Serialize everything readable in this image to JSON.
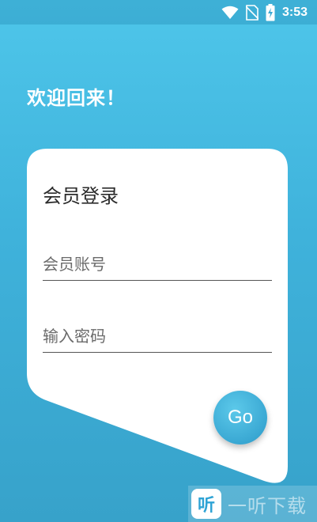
{
  "status_bar": {
    "time": "3:53",
    "icons": [
      "wifi-icon",
      "no-sim-icon",
      "battery-charging-icon"
    ]
  },
  "welcome_text": "欢迎回来！",
  "login_card": {
    "title": "会员登录",
    "account_placeholder": "会员账号",
    "password_placeholder": "输入密码",
    "go_label": "Go"
  },
  "watermark": {
    "logo_char": "听",
    "text": "一听下载"
  },
  "colors": {
    "background_top": "#4ec6ea",
    "background_bottom": "#37a2ca",
    "card": "#ffffff",
    "go_button": "#3aa8d3"
  }
}
